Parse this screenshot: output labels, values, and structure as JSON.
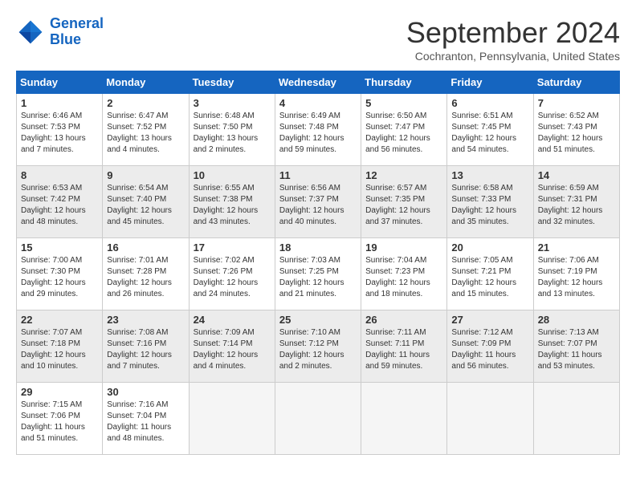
{
  "logo": {
    "line1": "General",
    "line2": "Blue"
  },
  "title": "September 2024",
  "location": "Cochranton, Pennsylvania, United States",
  "headers": [
    "Sunday",
    "Monday",
    "Tuesday",
    "Wednesday",
    "Thursday",
    "Friday",
    "Saturday"
  ],
  "weeks": [
    [
      {
        "day": "1",
        "info": "Sunrise: 6:46 AM\nSunset: 7:53 PM\nDaylight: 13 hours\nand 7 minutes."
      },
      {
        "day": "2",
        "info": "Sunrise: 6:47 AM\nSunset: 7:52 PM\nDaylight: 13 hours\nand 4 minutes."
      },
      {
        "day": "3",
        "info": "Sunrise: 6:48 AM\nSunset: 7:50 PM\nDaylight: 13 hours\nand 2 minutes."
      },
      {
        "day": "4",
        "info": "Sunrise: 6:49 AM\nSunset: 7:48 PM\nDaylight: 12 hours\nand 59 minutes."
      },
      {
        "day": "5",
        "info": "Sunrise: 6:50 AM\nSunset: 7:47 PM\nDaylight: 12 hours\nand 56 minutes."
      },
      {
        "day": "6",
        "info": "Sunrise: 6:51 AM\nSunset: 7:45 PM\nDaylight: 12 hours\nand 54 minutes."
      },
      {
        "day": "7",
        "info": "Sunrise: 6:52 AM\nSunset: 7:43 PM\nDaylight: 12 hours\nand 51 minutes."
      }
    ],
    [
      {
        "day": "8",
        "info": "Sunrise: 6:53 AM\nSunset: 7:42 PM\nDaylight: 12 hours\nand 48 minutes."
      },
      {
        "day": "9",
        "info": "Sunrise: 6:54 AM\nSunset: 7:40 PM\nDaylight: 12 hours\nand 45 minutes."
      },
      {
        "day": "10",
        "info": "Sunrise: 6:55 AM\nSunset: 7:38 PM\nDaylight: 12 hours\nand 43 minutes."
      },
      {
        "day": "11",
        "info": "Sunrise: 6:56 AM\nSunset: 7:37 PM\nDaylight: 12 hours\nand 40 minutes."
      },
      {
        "day": "12",
        "info": "Sunrise: 6:57 AM\nSunset: 7:35 PM\nDaylight: 12 hours\nand 37 minutes."
      },
      {
        "day": "13",
        "info": "Sunrise: 6:58 AM\nSunset: 7:33 PM\nDaylight: 12 hours\nand 35 minutes."
      },
      {
        "day": "14",
        "info": "Sunrise: 6:59 AM\nSunset: 7:31 PM\nDaylight: 12 hours\nand 32 minutes."
      }
    ],
    [
      {
        "day": "15",
        "info": "Sunrise: 7:00 AM\nSunset: 7:30 PM\nDaylight: 12 hours\nand 29 minutes."
      },
      {
        "day": "16",
        "info": "Sunrise: 7:01 AM\nSunset: 7:28 PM\nDaylight: 12 hours\nand 26 minutes."
      },
      {
        "day": "17",
        "info": "Sunrise: 7:02 AM\nSunset: 7:26 PM\nDaylight: 12 hours\nand 24 minutes."
      },
      {
        "day": "18",
        "info": "Sunrise: 7:03 AM\nSunset: 7:25 PM\nDaylight: 12 hours\nand 21 minutes."
      },
      {
        "day": "19",
        "info": "Sunrise: 7:04 AM\nSunset: 7:23 PM\nDaylight: 12 hours\nand 18 minutes."
      },
      {
        "day": "20",
        "info": "Sunrise: 7:05 AM\nSunset: 7:21 PM\nDaylight: 12 hours\nand 15 minutes."
      },
      {
        "day": "21",
        "info": "Sunrise: 7:06 AM\nSunset: 7:19 PM\nDaylight: 12 hours\nand 13 minutes."
      }
    ],
    [
      {
        "day": "22",
        "info": "Sunrise: 7:07 AM\nSunset: 7:18 PM\nDaylight: 12 hours\nand 10 minutes."
      },
      {
        "day": "23",
        "info": "Sunrise: 7:08 AM\nSunset: 7:16 PM\nDaylight: 12 hours\nand 7 minutes."
      },
      {
        "day": "24",
        "info": "Sunrise: 7:09 AM\nSunset: 7:14 PM\nDaylight: 12 hours\nand 4 minutes."
      },
      {
        "day": "25",
        "info": "Sunrise: 7:10 AM\nSunset: 7:12 PM\nDaylight: 12 hours\nand 2 minutes."
      },
      {
        "day": "26",
        "info": "Sunrise: 7:11 AM\nSunset: 7:11 PM\nDaylight: 11 hours\nand 59 minutes."
      },
      {
        "day": "27",
        "info": "Sunrise: 7:12 AM\nSunset: 7:09 PM\nDaylight: 11 hours\nand 56 minutes."
      },
      {
        "day": "28",
        "info": "Sunrise: 7:13 AM\nSunset: 7:07 PM\nDaylight: 11 hours\nand 53 minutes."
      }
    ],
    [
      {
        "day": "29",
        "info": "Sunrise: 7:15 AM\nSunset: 7:06 PM\nDaylight: 11 hours\nand 51 minutes."
      },
      {
        "day": "30",
        "info": "Sunrise: 7:16 AM\nSunset: 7:04 PM\nDaylight: 11 hours\nand 48 minutes."
      },
      {
        "day": "",
        "info": ""
      },
      {
        "day": "",
        "info": ""
      },
      {
        "day": "",
        "info": ""
      },
      {
        "day": "",
        "info": ""
      },
      {
        "day": "",
        "info": ""
      }
    ]
  ]
}
